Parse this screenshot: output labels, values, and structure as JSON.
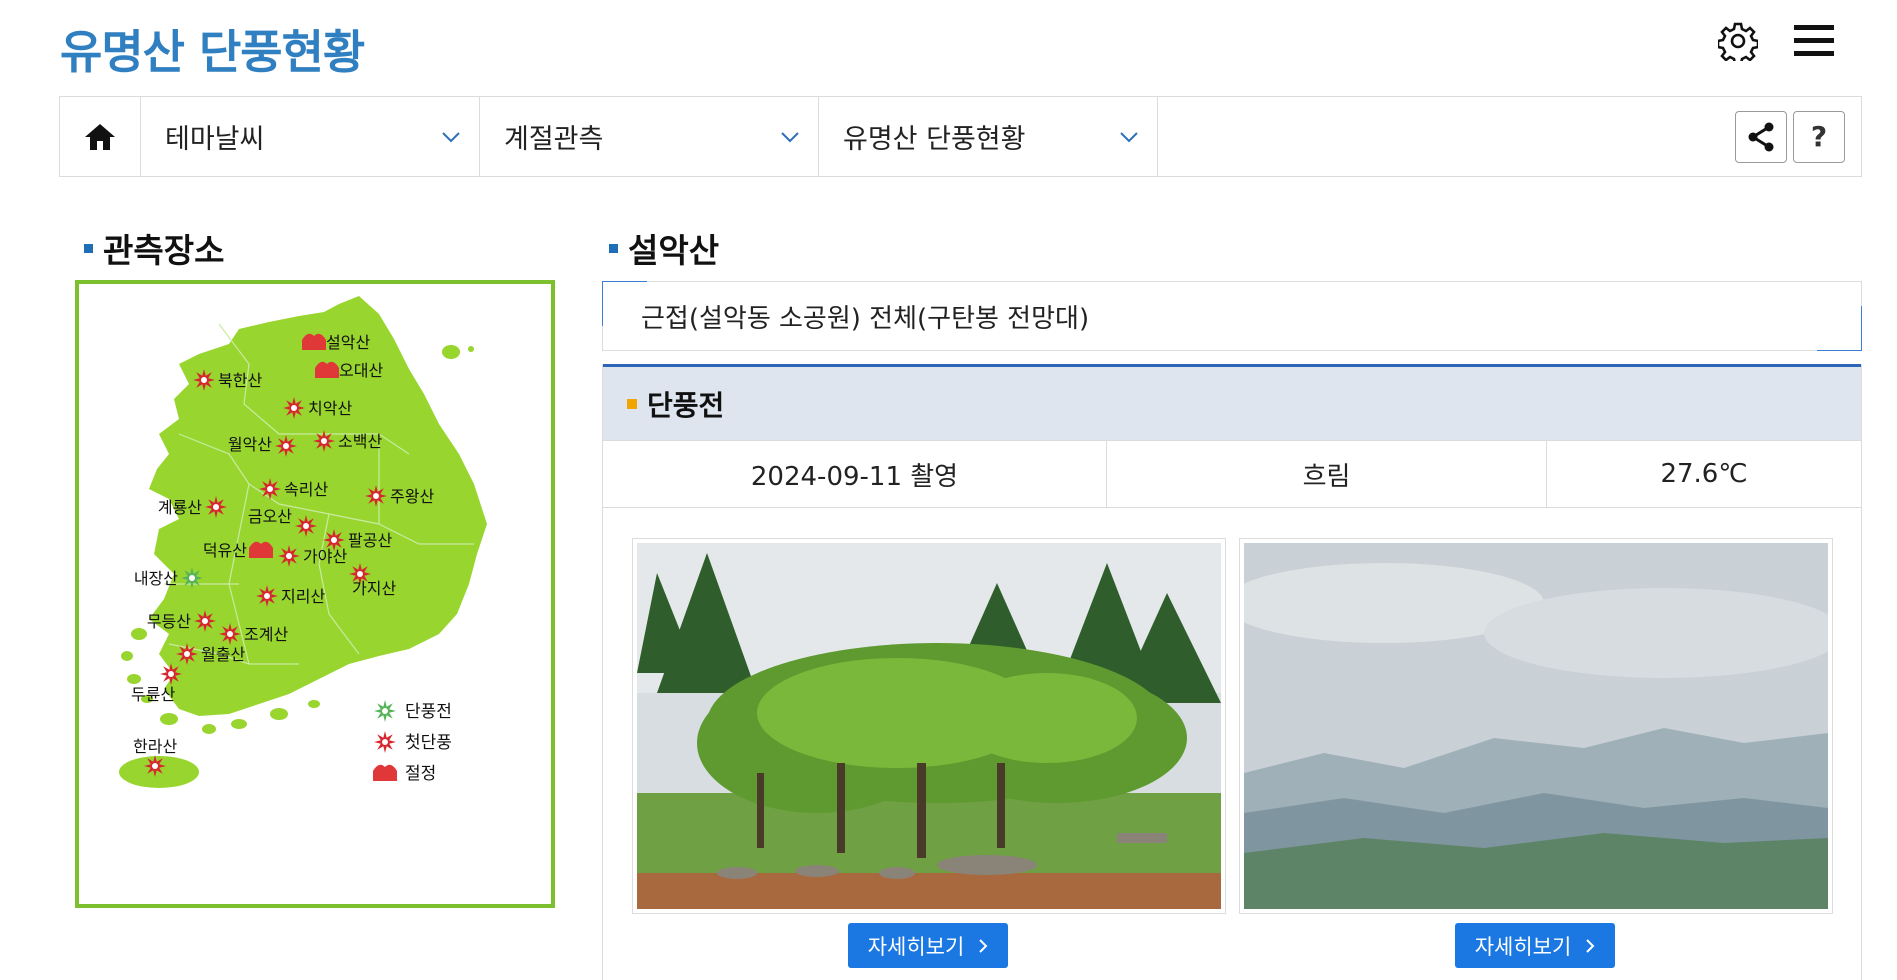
{
  "page": {
    "title": "유명산 단풍현황"
  },
  "icons": {
    "settings": "gear-icon",
    "menu": "hamburger-menu-icon",
    "home": "home-icon",
    "share": "share-icon",
    "help": "help-icon"
  },
  "nav": {
    "items": [
      {
        "label": "테마날씨"
      },
      {
        "label": "계절관측"
      },
      {
        "label": "유명산 단풍현황"
      }
    ],
    "help_label": "?"
  },
  "left": {
    "heading": "관측장소"
  },
  "map": {
    "mountains": [
      {
        "name": "설악산",
        "status": "peak"
      },
      {
        "name": "오대산",
        "status": "peak"
      },
      {
        "name": "북한산",
        "status": "first"
      },
      {
        "name": "치악산",
        "status": "first"
      },
      {
        "name": "월악산",
        "status": "first"
      },
      {
        "name": "소백산",
        "status": "first"
      },
      {
        "name": "속리산",
        "status": "first"
      },
      {
        "name": "주왕산",
        "status": "first"
      },
      {
        "name": "계룡산",
        "status": "first"
      },
      {
        "name": "금오산",
        "status": "first"
      },
      {
        "name": "팔공산",
        "status": "first"
      },
      {
        "name": "덕유산",
        "status": "peak"
      },
      {
        "name": "가야산",
        "status": "first"
      },
      {
        "name": "내장산",
        "status": "before"
      },
      {
        "name": "가지산",
        "status": "first"
      },
      {
        "name": "지리산",
        "status": "first"
      },
      {
        "name": "무등산",
        "status": "first"
      },
      {
        "name": "조계산",
        "status": "first"
      },
      {
        "name": "월출산",
        "status": "first"
      },
      {
        "name": "두륜산",
        "status": "first"
      },
      {
        "name": "한라산",
        "status": "first"
      }
    ],
    "legend": [
      {
        "label": "단풍전",
        "status": "before"
      },
      {
        "label": "첫단풍",
        "status": "first"
      },
      {
        "label": "절정",
        "status": "peak"
      }
    ],
    "colors": {
      "land": "#99d52f",
      "border": "#7dc02d",
      "first": "#d7262e",
      "peak": "#e03838",
      "before": "#57b35a"
    }
  },
  "right": {
    "heading": "설악산",
    "site": "근접(설악동 소공원) 전체(구탄봉 전망대)",
    "stage": "단풍전",
    "info": {
      "date": "2024-09-11 촬영",
      "weather": "흐림",
      "temp": "27.6℃"
    },
    "photos": [
      {
        "button": "자세히보기"
      },
      {
        "button": "자세히보기"
      }
    ]
  },
  "colors": {
    "title": "#2f7fc1",
    "button": "#1b78e2",
    "panel_head": "#dee5ee",
    "panel_line": "#2a66b8"
  }
}
